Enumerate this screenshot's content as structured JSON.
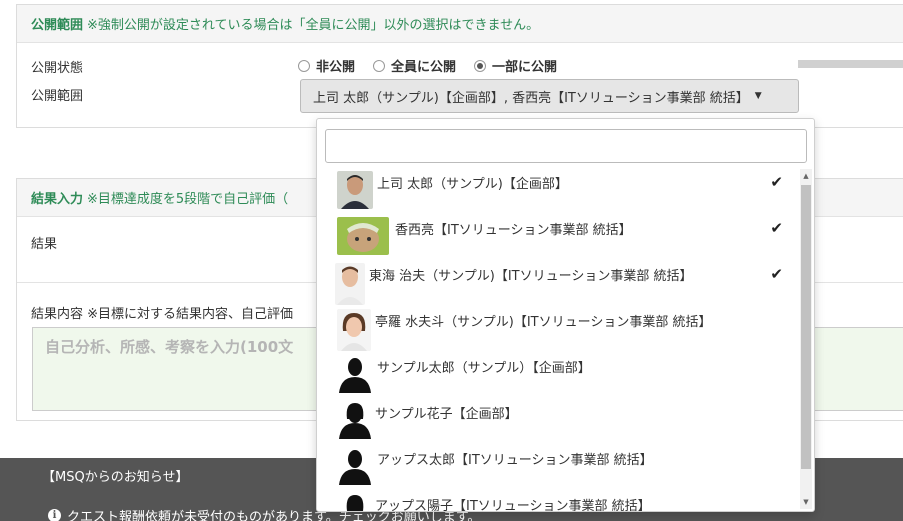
{
  "visibility_panel": {
    "title": "公開範囲",
    "note": "※強制公開が設定されている場合は「全員に公開」以外の選択はできません。",
    "status_label": "公開状態",
    "scope_label": "公開範囲",
    "radios": [
      {
        "label": "非公開",
        "checked": false
      },
      {
        "label": "全員に公開",
        "checked": false
      },
      {
        "label": "一部に公開",
        "checked": true
      }
    ],
    "select_value": "上司 太郎（サンプル)【企画部】, 香西亮【ITソリューション事業部 統括】"
  },
  "result_panel": {
    "title": "結果入力",
    "note": "※目標達成度を5段階で自己評価（",
    "result_label": "結果",
    "content_label": "結果内容 ※目標に対する結果内容、自己評価",
    "textarea_placeholder": "自己分析、所感、考察を入力(100文"
  },
  "footer": {
    "title": "【MSQからのお知らせ】",
    "notice": "クエスト報酬依頼が未受付のものがあります。チェックお願いします。"
  },
  "dropdown": {
    "search_value": "",
    "items": [
      {
        "name": "上司 太郎（サンプル)【企画部】",
        "avatar": "photo-man",
        "checked": true
      },
      {
        "name": "香西亮【ITソリューション事業部 統括】",
        "avatar": "photo-cat",
        "checked": true
      },
      {
        "name": "東海 治夫（サンプル)【ITソリューション事業部 統括】",
        "avatar": "photo-man2",
        "checked": true
      },
      {
        "name": "亭羅 水夫斗（サンプル)【ITソリューション事業部 統括】",
        "avatar": "photo-woman",
        "checked": false
      },
      {
        "name": "サンプル太郎（サンプル）【企画部】",
        "avatar": "silhouette-man",
        "checked": false
      },
      {
        "name": "サンプル花子【企画部】",
        "avatar": "silhouette-woman",
        "checked": false
      },
      {
        "name": "アップス太郎【ITソリューション事業部 統括】",
        "avatar": "silhouette-man",
        "checked": false
      },
      {
        "name": "アップス陽子【ITソリューション事業部 統括】",
        "avatar": "silhouette-woman",
        "checked": false
      }
    ],
    "check_glyph": "✔"
  },
  "colors": {
    "accent_green": "#2e8b57",
    "footer_bg": "#555555",
    "textarea_bg": "#f0f8ec"
  }
}
